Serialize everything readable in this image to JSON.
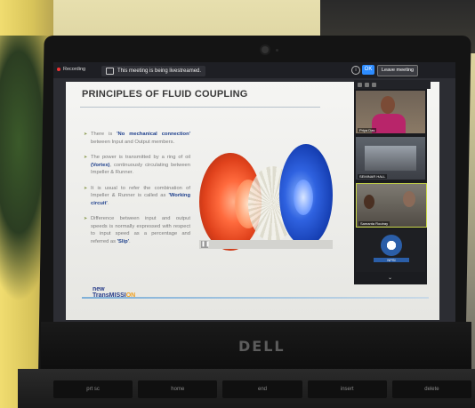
{
  "zoom": {
    "recording_label": "Recording",
    "livestream_notice": "This meeting is being livestreamed.",
    "ok_label": "OK",
    "leave_label": "Leave meeting"
  },
  "slide": {
    "title": "PRINCIPLES OF FLUID COUPLING",
    "bullets": [
      {
        "before": "There is ",
        "highlight": "'No mechanical connection'",
        "after": " between Input and Output members."
      },
      {
        "before": "The power is transmitted by a ring of oil ",
        "highlight": "(Vortex)",
        "after": ", continuously circulating between Impeller & Runner."
      },
      {
        "before": "It is usual to refer the combination of Impeller & Runner is called as ",
        "highlight": "'Working circuit'",
        "after": "."
      },
      {
        "before": "Difference between input and output speeds is normally expressed with respect to input speed as a percentage and referred as ",
        "highlight": "'Slip'",
        "after": "."
      }
    ],
    "footer_logo_line1": "new",
    "footer_logo_line2a": "TransMISSI",
    "footer_logo_line2b": "ON"
  },
  "participants": [
    {
      "name": "Priya Das"
    },
    {
      "name": "SEMINAR HALL"
    },
    {
      "name": "Samanta Routray"
    },
    {
      "name": "NPSI"
    }
  ],
  "brand": {
    "laptop": "DELL"
  },
  "keys": [
    "prt sc",
    "home",
    "end",
    "insert",
    "delete"
  ],
  "colors": {
    "zoom_blue": "#2d8cff",
    "highlight_blue": "#1d3f8c",
    "impeller": "#e0421c",
    "runner": "#163fb3"
  }
}
